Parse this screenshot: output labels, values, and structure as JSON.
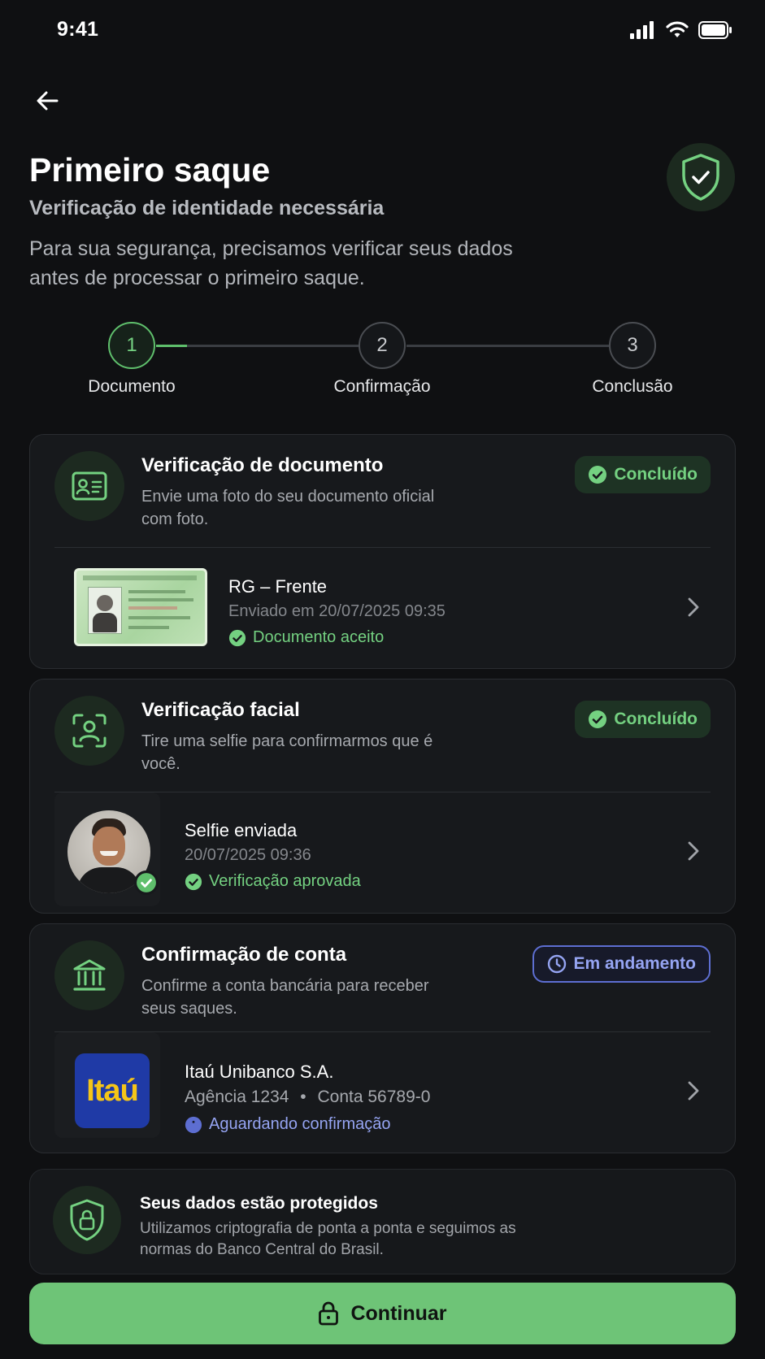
{
  "status_bar": {
    "time": "9:41"
  },
  "header": {
    "title": "Primeiro saque",
    "subtitle": "Verificação de identidade necessária",
    "description": "Para sua segurança, precisamos verificar seus dados antes de processar o primeiro saque."
  },
  "stepper": {
    "steps": [
      {
        "number": "1",
        "label": "Documento",
        "state": "active"
      },
      {
        "number": "2",
        "label": "Confirmação",
        "state": "inactive"
      },
      {
        "number": "3",
        "label": "Conclusão",
        "state": "inactive"
      }
    ]
  },
  "cards": {
    "document": {
      "title": "Verificação de documento",
      "description": "Envie uma foto do seu documento oficial com foto.",
      "badge": "Concluído",
      "item_name": "RG – Frente",
      "item_meta": "Enviado em 20/07/2025 09:35",
      "item_status": "Documento aceito"
    },
    "facial": {
      "title": "Verificação facial",
      "description": "Tire uma selfie para confirmarmos que é você.",
      "badge": "Concluído",
      "item_name": "Selfie enviada",
      "item_meta": "20/07/2025 09:36",
      "item_status": "Verificação aprovada"
    },
    "account": {
      "title": "Confirmação de conta",
      "description": "Confirme a conta bancária para receber seus saques.",
      "badge": "Em andamento",
      "bank_logo": "Itaú",
      "item_name": "Itaú Unibanco S.A.",
      "item_agency": "Agência 1234",
      "item_account": "Conta 56789-0",
      "item_separator": "•",
      "item_status": "Aguardando confirmação"
    }
  },
  "security": {
    "title": "Seus dados estão protegidos",
    "description": "Utilizamos criptografia de ponta a ponta e seguimos as normas do Banco Central do Brasil."
  },
  "footer": {
    "button_label": "Continuar"
  },
  "colors": {
    "background": "#0f1012",
    "accent_green": "#6ec477",
    "pending_blue": "#95a4f2",
    "card_bg": "#17191c",
    "itau_blue": "#1f3aa6",
    "itau_yellow": "#f5c518"
  },
  "icons": [
    "back-arrow-icon",
    "shield-check-icon",
    "id-card-icon",
    "face-scan-icon",
    "bank-icon",
    "check-circle-icon",
    "clock-icon",
    "chevron-right-icon",
    "shield-lock-icon",
    "lock-icon",
    "signal-icon",
    "wifi-icon",
    "battery-icon"
  ]
}
